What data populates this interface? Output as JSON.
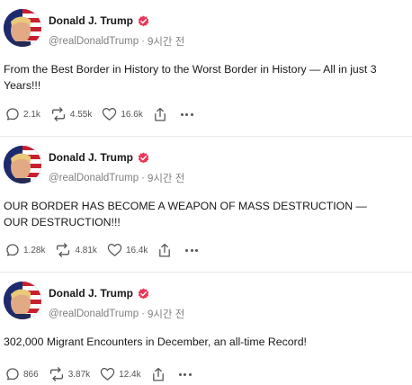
{
  "posts": [
    {
      "author": "Donald J. Trump",
      "handle": "@realDonaldTrump",
      "separator": "·",
      "time": "9시간 전",
      "text": "From the Best Border in History to the Worst Border in History — All in just 3 Years!!!",
      "replies": "2.1k",
      "reposts": "4.55k",
      "likes": "16.6k"
    },
    {
      "author": "Donald J. Trump",
      "handle": "@realDonaldTrump",
      "separator": "·",
      "time": "9시간 전",
      "text": "OUR BORDER HAS BECOME A WEAPON OF MASS DESTRUCTION — OUR DESTRUCTION!!!",
      "replies": "1.28k",
      "reposts": "4.81k",
      "likes": "16.4k"
    },
    {
      "author": "Donald J. Trump",
      "handle": "@realDonaldTrump",
      "separator": "·",
      "time": "9시간 전",
      "text": "302,000 Migrant Encounters in December, an all-time Record!",
      "replies": "866",
      "reposts": "3.87k",
      "likes": "12.4k"
    }
  ],
  "icons": {
    "verified": "verified-badge-icon",
    "reply": "reply-bubble-icon",
    "repost": "repost-arrows-icon",
    "like": "heart-icon",
    "share": "share-upload-icon",
    "more": "more-dots-icon"
  },
  "colors": {
    "verified": "#e8385a",
    "text": "#171717",
    "muted": "#808080"
  }
}
